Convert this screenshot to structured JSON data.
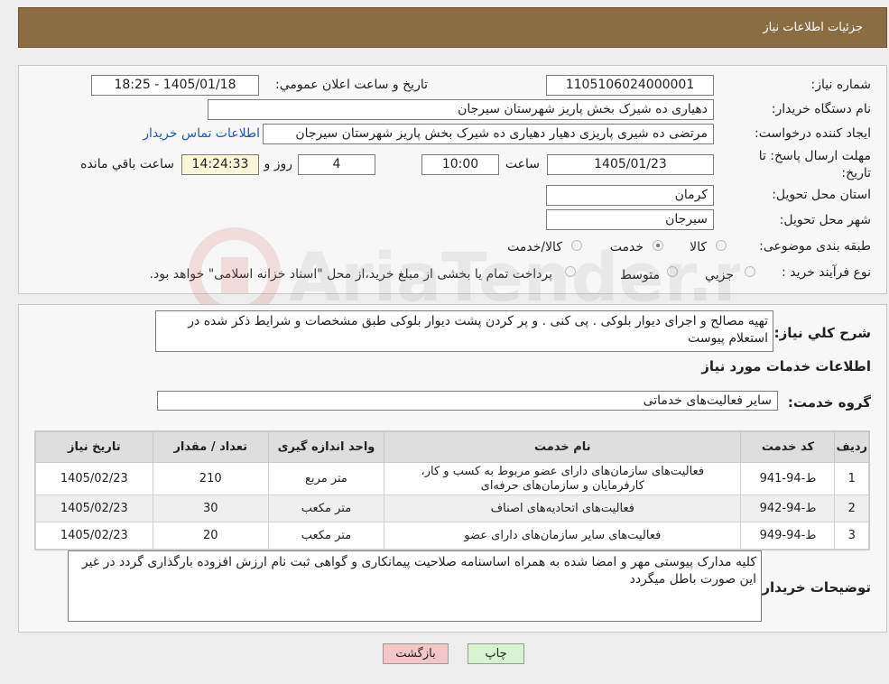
{
  "header": {
    "title": "جزئیات اطلاعات نیاز"
  },
  "form": {
    "need_number_label": "شماره نیاز:",
    "need_number": "1105106024000001",
    "announce_label": "تاریخ و ساعت اعلان عمومي:",
    "announce_value": "1405/01/18 - 18:25",
    "buyer_org_label": "نام دستگاه خريدار:",
    "buyer_org": "دهیاری ده شیرک بخش پاریز شهرستان سیرجان",
    "creator_label": "ايجاد کننده درخواست:",
    "creator": "مرتضی ده شیری پاریزی دهیار دهیاری ده شیرک بخش پاریز شهرستان سیرجان",
    "contact_link": "اطلاعات تماس خریدار",
    "deadline_label_line1": "مهلت ارسال پاسخ: تا",
    "deadline_label_line2": "تاریخ:",
    "deadline_date": "1405/01/23",
    "time_label": "ساعت",
    "deadline_time": "10:00",
    "days_value": "4",
    "days_label": "روز و",
    "remaining_time": "14:24:33",
    "remaining_label": "ساعت باقي مانده",
    "province_label": "استان محل تحویل:",
    "province": "کرمان",
    "city_label": "شهر محل تحویل:",
    "city": "سیرجان",
    "category_label": "طبقه بندی موضوعی:",
    "category_options": [
      "کالا",
      "خدمت",
      "کالا/خدمت"
    ],
    "category_selected": "خدمت",
    "purchase_type_label": "نوع فرآیند خرید :",
    "purchase_options": [
      "جزیي",
      "متوسط"
    ],
    "purchase_note": "پرداخت تمام یا بخشی از مبلغ خرید،از محل \"اسناد خزانه اسلامی\" خواهد بود."
  },
  "details": {
    "summary_label": "شرح کلي نياز:",
    "summary": "تهیه مصالح و اجرای دیوار بلوکی . پی کنی . و پر کردن پشت دیوار بلوکی طبق مشخصات و شرایط ذکر شده در استعلام پیوست",
    "services_title": "اطلاعات خدمات مورد نياز",
    "group_label": "گروه خدمت:",
    "group_value": "سایر فعالیت‌های خدماتی",
    "table": {
      "headers": [
        "رديف",
        "کد خدمت",
        "نام خدمت",
        "واحد اندازه گیری",
        "تعداد / مقدار",
        "تاریخ نیاز"
      ],
      "rows": [
        [
          "1",
          "ط-94-941",
          "فعالیت‌های سازمان‌های دارای عضو مربوط به کسب و کار، کارفرمایان و سازمان‌های حرفه‌ای",
          "متر مربع",
          "210",
          "1405/02/23"
        ],
        [
          "2",
          "ط-94-942",
          "فعالیت‌های اتحادیه‌های اصناف",
          "متر مکعب",
          "30",
          "1405/02/23"
        ],
        [
          "3",
          "ط-94-949",
          "فعالیت‌های سایر سازمان‌های دارای عضو",
          "متر مکعب",
          "20",
          "1405/02/23"
        ]
      ]
    },
    "notes_label": "توضیحات خریدار:",
    "notes": "کلیه مدارک پیوستی مهر و امضا شده به همراه اساسنامه صلاحیت پیمانکاری و گواهی ثبت نام ارزش افزوده بارگذاری گردد در غیر این صورت باطل میگردد"
  },
  "buttons": {
    "print": "چاپ",
    "back": "بازگشت"
  },
  "watermark": {
    "text": "AriaTender.neT"
  },
  "colors": {
    "header_bg": "#8b6d44",
    "back_btn_bg": "#f4c6c6",
    "print_btn_bg": "#d6f2cf",
    "link": "#1d59b8"
  }
}
